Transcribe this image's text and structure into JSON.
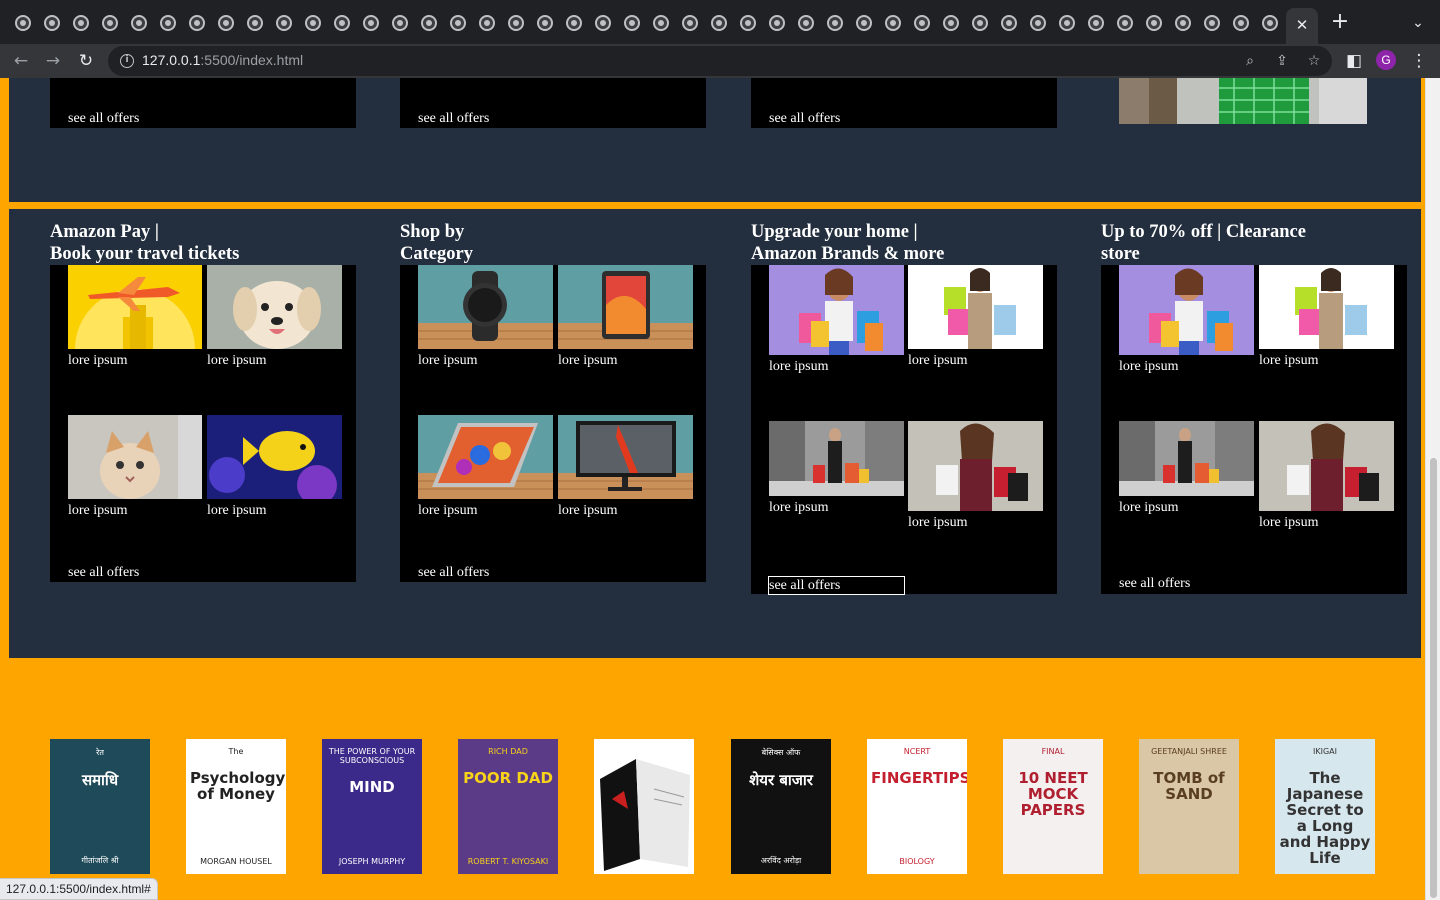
{
  "browser": {
    "url_host": "127.0.0.1",
    "url_rest": ":5500/index.html",
    "active_tab_close": "✕",
    "status_url": "127.0.0.1:5500/index.html#"
  },
  "top_row": {
    "see_all": [
      "see all offers",
      "see all offers",
      "see all offers"
    ]
  },
  "cards": [
    {
      "title_line1": "Amazon Pay |",
      "title_line2": "Book your travel tickets",
      "items": [
        "lore ipsum",
        "lore ipsum",
        "lore ipsum",
        "lore ipsum"
      ],
      "see_all": "see all offers"
    },
    {
      "title_line1": "Shop by",
      "title_line2": "Category",
      "items": [
        "lore ipsum",
        "lore ipsum",
        "lore ipsum",
        "lore ipsum"
      ],
      "see_all": "see all offers"
    },
    {
      "title_line1": "Upgrade your home |",
      "title_line2": "Amazon Brands & more",
      "items": [
        "lore ipsum",
        "lore ipsum",
        "lore ipsum",
        "lore ipsum"
      ],
      "see_all": "see all offers"
    },
    {
      "title_line1": "Up to 70% off | Clearance",
      "title_line2": "store",
      "items": [
        "lore ipsum",
        "lore ipsum",
        "lore ipsum",
        "lore ipsum"
      ],
      "see_all": "see all offers"
    }
  ],
  "books": [
    {
      "t1": "रेत",
      "t2": "समाधि",
      "t3": "गीतांजलि श्री",
      "bg": "#1f4a5a",
      "fg": "#ffffff"
    },
    {
      "t1": "The",
      "t2": "Psychology of Money",
      "t3": "MORGAN HOUSEL",
      "bg": "#ffffff",
      "fg": "#222222"
    },
    {
      "t1": "THE POWER OF YOUR SUBCONSCIOUS",
      "t2": "MIND",
      "t3": "JOSEPH MURPHY",
      "bg": "#3b2a8a",
      "fg": "#ffffff"
    },
    {
      "t1": "RICH DAD",
      "t2": "POOR DAD",
      "t3": "ROBERT T. KIYOSAKI",
      "bg": "#5b3a87",
      "fg": "#f7d31a"
    },
    {
      "t1": "",
      "t2": "",
      "t3": "",
      "bg": "#e9e9e9",
      "fg": "#000000"
    },
    {
      "t1": "बेसिक्स ऑफ",
      "t2": "शेयर बाजार",
      "t3": "अरविंद अरोड़ा",
      "bg": "#111111",
      "fg": "#ffffff"
    },
    {
      "t1": "NCERT",
      "t2": "FINGERTIPS",
      "t3": "BIOLOGY",
      "bg": "#ffffff",
      "fg": "#c31f2e"
    },
    {
      "t1": "FINAL",
      "t2": "10 NEET MOCK PAPERS",
      "t3": "",
      "bg": "#f4f0f0",
      "fg": "#b01f2f"
    },
    {
      "t1": "GEETANJALI SHREE",
      "t2": "TOMB of SAND",
      "t3": "",
      "bg": "#d9c7a5",
      "fg": "#5a3e22"
    },
    {
      "t1": "IKIGAI",
      "t2": "The Japanese Secret to a Long and Happy Life",
      "t3": "",
      "bg": "#d7e7ee",
      "fg": "#333333"
    }
  ]
}
